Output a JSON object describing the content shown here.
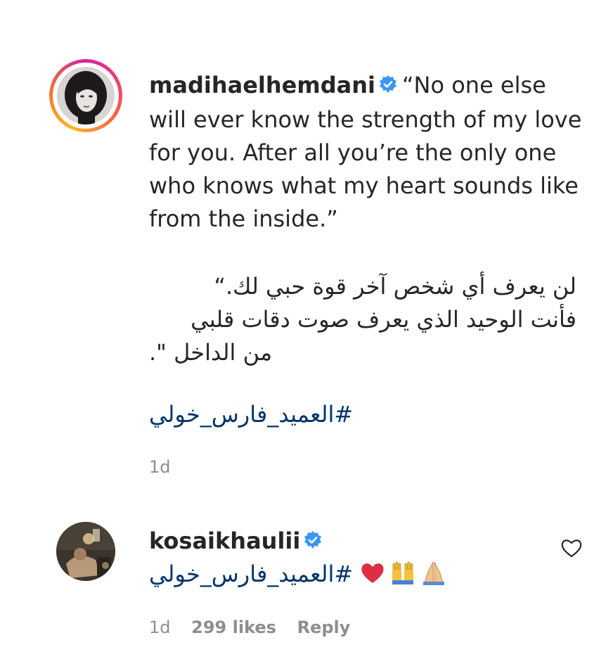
{
  "comments": [
    {
      "username": "madihaelhemdani",
      "verified": true,
      "text_en": "“No one else will ever know the strength of my love for you. After all you’re the only one who knows what my heart sounds like from the inside.”",
      "text_ar_1": "لن يعرف أي شخص آخر قوة حبي لك.“",
      "text_ar_2": "فأنت الوحيد الذي يعرف صوت دقات قلبي",
      "text_ar_3": "من الداخل \".",
      "hashtag": "#العميد_فارس_خولي",
      "time": "1d"
    },
    {
      "username": "kosaikhaulii",
      "verified": true,
      "hashtag": "#العميد_فارس_خولي",
      "emojis": [
        "red-heart",
        "raising-hands",
        "folded-hands"
      ],
      "time": "1d",
      "likes": "299 likes",
      "reply": "Reply"
    }
  ],
  "colors": {
    "hashtag": "#003569",
    "verified": "#3897f0",
    "meta": "#8e8e8e"
  }
}
